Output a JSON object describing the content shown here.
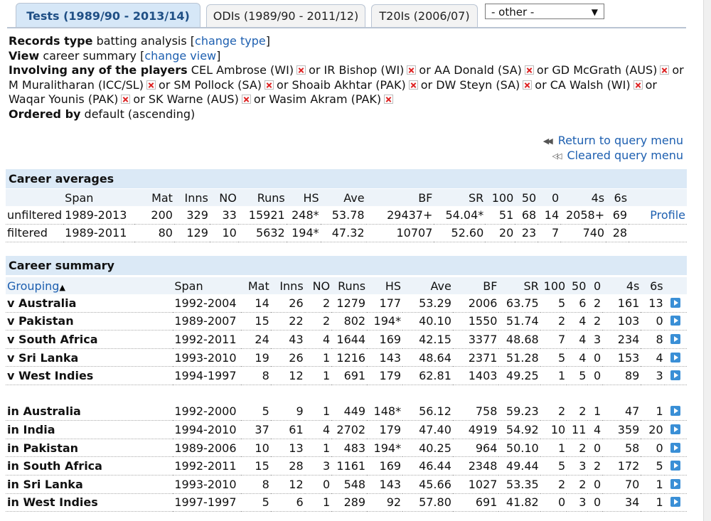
{
  "tabs": [
    {
      "label": "Tests (1989/90 - 2013/14)",
      "active": true
    },
    {
      "label": "ODIs (1989/90 - 2011/12)",
      "active": false
    },
    {
      "label": "T20Is (2006/07)",
      "active": false
    }
  ],
  "other_select": {
    "value": "- other -"
  },
  "info": {
    "records_type_label": "Records type",
    "records_type_value": "batting analysis",
    "change_type": "change type",
    "view_label": "View",
    "view_value": "career summary",
    "change_view": "change view",
    "involving_label": "Involving any of the players",
    "players": [
      "CEL Ambrose (WI)",
      "IR Bishop (WI)",
      "AA Donald (SA)",
      "GD McGrath (AUS)",
      "M Muralitharan (ICC/SL)",
      "SM Pollock (SA)",
      "Shoaib Akhtar (PAK)",
      "DW Steyn (SA)",
      "CA Walsh (WI)",
      "Waqar Younis (PAK)",
      "SK Warne (AUS)",
      "Wasim Akram (PAK)"
    ],
    "or_word": "or",
    "ordered_label": "Ordered by",
    "ordered_value": "default (ascending)"
  },
  "query_links": {
    "return": "Return to query menu",
    "cleared": "Cleared query menu"
  },
  "career_averages": {
    "title": "Career averages",
    "headers": [
      "Span",
      "Mat",
      "Inns",
      "NO",
      "Runs",
      "HS",
      "Ave",
      "BF",
      "SR",
      "100",
      "50",
      "0",
      "4s",
      "6s"
    ],
    "rows": [
      {
        "label": "unfiltered",
        "cells": [
          "1989-2013",
          "200",
          "329",
          "33",
          "15921",
          "248*",
          "53.78",
          "29437+",
          "54.04*",
          "51",
          "68",
          "14",
          "2058+",
          "69"
        ],
        "link": "Profile"
      },
      {
        "label": "filtered",
        "cells": [
          "1989-2011",
          "80",
          "129",
          "10",
          "5632",
          "194*",
          "47.32",
          "10707",
          "52.60",
          "20",
          "23",
          "7",
          "740",
          "28"
        ],
        "link": ""
      }
    ]
  },
  "career_summary": {
    "title": "Career summary",
    "grouping_header": "Grouping",
    "headers": [
      "Span",
      "Mat",
      "Inns",
      "NO",
      "Runs",
      "HS",
      "Ave",
      "BF",
      "SR",
      "100",
      "50",
      "0",
      "4s",
      "6s"
    ],
    "vs_rows": [
      {
        "label": "v Australia",
        "cells": [
          "1992-2004",
          "14",
          "26",
          "2",
          "1279",
          "177",
          "53.29",
          "2006",
          "63.75",
          "5",
          "6",
          "2",
          "161",
          "13"
        ]
      },
      {
        "label": "v Pakistan",
        "cells": [
          "1989-2007",
          "15",
          "22",
          "2",
          "802",
          "194*",
          "40.10",
          "1550",
          "51.74",
          "2",
          "4",
          "2",
          "103",
          "0"
        ]
      },
      {
        "label": "v South Africa",
        "cells": [
          "1992-2011",
          "24",
          "43",
          "4",
          "1644",
          "169",
          "42.15",
          "3377",
          "48.68",
          "7",
          "4",
          "3",
          "234",
          "8"
        ]
      },
      {
        "label": "v Sri Lanka",
        "cells": [
          "1993-2010",
          "19",
          "26",
          "1",
          "1216",
          "143",
          "48.64",
          "2371",
          "51.28",
          "5",
          "4",
          "0",
          "153",
          "4"
        ]
      },
      {
        "label": "v West Indies",
        "cells": [
          "1994-1997",
          "8",
          "12",
          "1",
          "691",
          "179",
          "62.81",
          "1403",
          "49.25",
          "1",
          "5",
          "0",
          "89",
          "3"
        ]
      }
    ],
    "in_rows": [
      {
        "label": "in Australia",
        "cells": [
          "1992-2000",
          "5",
          "9",
          "1",
          "449",
          "148*",
          "56.12",
          "758",
          "59.23",
          "2",
          "2",
          "1",
          "47",
          "1"
        ]
      },
      {
        "label": "in India",
        "cells": [
          "1994-2010",
          "37",
          "61",
          "4",
          "2702",
          "179",
          "47.40",
          "4919",
          "54.92",
          "10",
          "11",
          "4",
          "359",
          "20"
        ]
      },
      {
        "label": "in Pakistan",
        "cells": [
          "1989-2006",
          "10",
          "13",
          "1",
          "483",
          "194*",
          "40.25",
          "964",
          "50.10",
          "1",
          "2",
          "0",
          "58",
          "0"
        ]
      },
      {
        "label": "in South Africa",
        "cells": [
          "1992-2011",
          "15",
          "28",
          "3",
          "1161",
          "169",
          "46.44",
          "2348",
          "49.44",
          "5",
          "3",
          "2",
          "172",
          "5"
        ]
      },
      {
        "label": "in Sri Lanka",
        "cells": [
          "1993-2010",
          "8",
          "12",
          "0",
          "548",
          "143",
          "45.66",
          "1027",
          "53.35",
          "2",
          "2",
          "0",
          "70",
          "1"
        ]
      },
      {
        "label": "in West Indies",
        "cells": [
          "1997-1997",
          "5",
          "6",
          "1",
          "289",
          "92",
          "57.80",
          "691",
          "41.82",
          "0",
          "3",
          "0",
          "34",
          "1"
        ]
      }
    ]
  },
  "colors": {
    "accent": "#1d5fb0",
    "section_bg": "#dbe9f6",
    "remove_x": "#dd2222"
  },
  "icons": {
    "remove": "remove-x-icon",
    "play": "play-icon",
    "rewind": "rewind-icon",
    "sort": "sort-up-icon"
  }
}
